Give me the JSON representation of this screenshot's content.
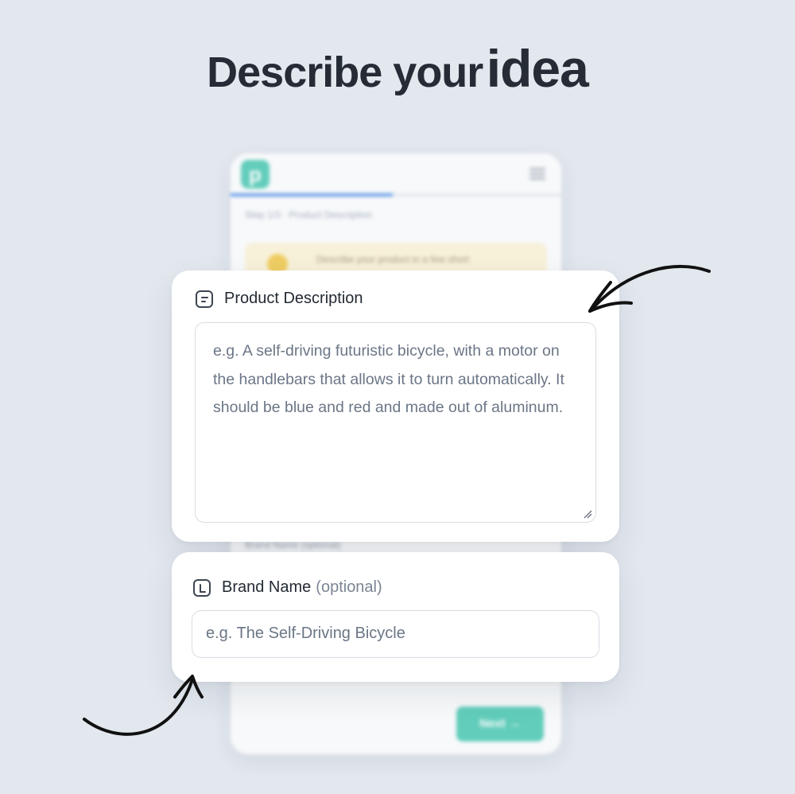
{
  "headline": {
    "text_normal": "Describe your",
    "text_emphasis": "idea"
  },
  "background_app": {
    "logo_letter": "p",
    "step_text": "Step 1/3 · Product Description",
    "progress_fraction": 0.49,
    "hint_text": "Describe your product in a few short",
    "brand_peek": "Brand Name (optional)",
    "next_label": "Next →"
  },
  "product_description": {
    "label": "Product Description",
    "placeholder": "e.g. A self-driving futuristic bicycle, with a motor on the handlebars that allows it to turn automatically. It should be blue and red and made out of aluminum."
  },
  "brand_name": {
    "label": "Brand Name",
    "optional_label": "(optional)",
    "placeholder": "e.g. The Self-Driving Bicycle"
  },
  "colors": {
    "accent": "#4cc9b2",
    "progress": "#4f8ee6",
    "background": "#e3e8ef"
  }
}
